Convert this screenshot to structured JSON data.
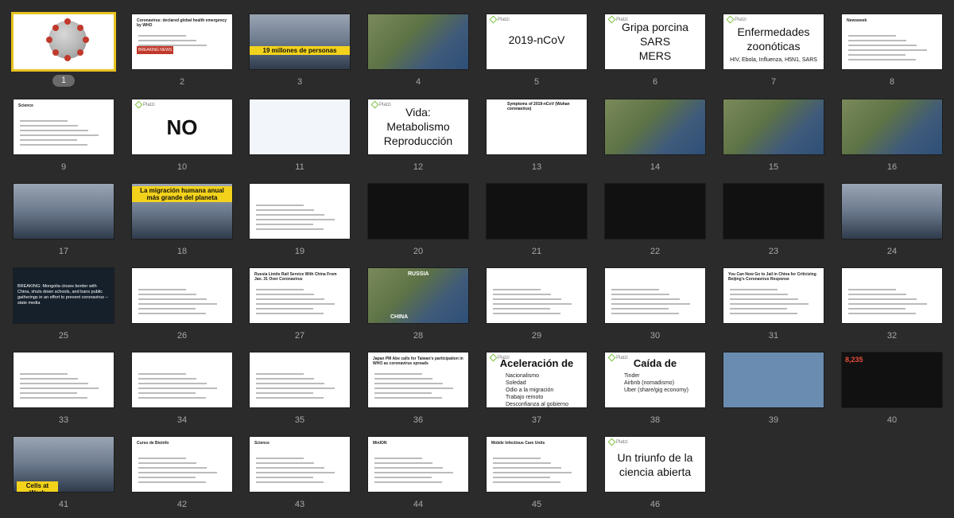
{
  "slides": [
    {
      "num": "1",
      "kind": "virus",
      "selected": true
    },
    {
      "num": "2",
      "kind": "article",
      "headline": "Coronavirus: declared global health emergency by WHO",
      "badge": "BREAKING NEWS"
    },
    {
      "num": "3",
      "kind": "photo-band",
      "band": "19 millones de personas"
    },
    {
      "num": "4",
      "kind": "map"
    },
    {
      "num": "5",
      "kind": "text",
      "lines": [
        "2019-nCoV"
      ]
    },
    {
      "num": "6",
      "kind": "text",
      "lines": [
        "Gripa porcina",
        "SARS",
        "MERS"
      ]
    },
    {
      "num": "7",
      "kind": "text",
      "lines": [
        "Enfermedades",
        "zoonóticas"
      ],
      "sub": "HIV, Ebola, Influenza, H5N1, SARS"
    },
    {
      "num": "8",
      "kind": "article",
      "headline": "Newsweek"
    },
    {
      "num": "9",
      "kind": "article",
      "headline": "Science"
    },
    {
      "num": "10",
      "kind": "big",
      "lines": [
        "NO"
      ]
    },
    {
      "num": "11",
      "kind": "diagram"
    },
    {
      "num": "12",
      "kind": "text",
      "lines": [
        "Vida:",
        "Metabolismo",
        "Reproducción"
      ]
    },
    {
      "num": "13",
      "kind": "symptoms",
      "headline": "Symptoms of 2019-nCoV (Wuhan coronavirus)"
    },
    {
      "num": "14",
      "kind": "map"
    },
    {
      "num": "15",
      "kind": "map"
    },
    {
      "num": "16",
      "kind": "map"
    },
    {
      "num": "17",
      "kind": "photo"
    },
    {
      "num": "18",
      "kind": "photo-band",
      "band": "La migración humana anual más grande del planeta"
    },
    {
      "num": "19",
      "kind": "article"
    },
    {
      "num": "20",
      "kind": "dark"
    },
    {
      "num": "21",
      "kind": "dark"
    },
    {
      "num": "22",
      "kind": "dark"
    },
    {
      "num": "23",
      "kind": "dark"
    },
    {
      "num": "24",
      "kind": "photo"
    },
    {
      "num": "25",
      "kind": "tweet",
      "text": "BREAKING: Mongolia closes border with China, shuts down schools, and bans public gatherings in an effort to prevent coronavirus – state media"
    },
    {
      "num": "26",
      "kind": "article"
    },
    {
      "num": "27",
      "kind": "article",
      "headline": "Russia Limits Rail Service With China From Jan. 31 Over Coronavirus"
    },
    {
      "num": "28",
      "kind": "map",
      "labels": [
        "RUSSIA",
        "CHINA"
      ]
    },
    {
      "num": "29",
      "kind": "article"
    },
    {
      "num": "30",
      "kind": "article"
    },
    {
      "num": "31",
      "kind": "article",
      "headline": "You Can Now Go to Jail in China for Criticizing Beijing's Coronavirus Response"
    },
    {
      "num": "32",
      "kind": "article"
    },
    {
      "num": "33",
      "kind": "article"
    },
    {
      "num": "34",
      "kind": "article"
    },
    {
      "num": "35",
      "kind": "article"
    },
    {
      "num": "36",
      "kind": "article",
      "headline": "Japan PM Abe calls for Taiwan's participation in WHO as coronavirus spreads"
    },
    {
      "num": "37",
      "kind": "list",
      "title": "Aceleración de",
      "items": [
        "Nacionalismo",
        "Soledad",
        "Odio a la migración",
        "Trabajo remoto",
        "Desconfianza al gobierno"
      ]
    },
    {
      "num": "38",
      "kind": "list",
      "title": "Caída de",
      "items": [
        "Tinder",
        "Airbnb (nomadismo)",
        "Uber (share/gig economy)"
      ]
    },
    {
      "num": "39",
      "kind": "cartoon"
    },
    {
      "num": "40",
      "kind": "dark",
      "big": "8,235"
    },
    {
      "num": "41",
      "kind": "photo-band",
      "band": "Cells at Work"
    },
    {
      "num": "42",
      "kind": "article",
      "headline": "Curso de Bioinfo"
    },
    {
      "num": "43",
      "kind": "article",
      "headline": "Science"
    },
    {
      "num": "44",
      "kind": "article",
      "headline": "MinION"
    },
    {
      "num": "45",
      "kind": "article",
      "headline": "Mobile Infectious Care Units"
    },
    {
      "num": "46",
      "kind": "text",
      "lines": [
        "Un triunfo de la",
        "ciencia abierta"
      ]
    }
  ],
  "branding": "Platzi",
  "colors": {
    "selection": "#e7c21f",
    "background": "#2b2b2b",
    "accent": "#7dc242"
  }
}
